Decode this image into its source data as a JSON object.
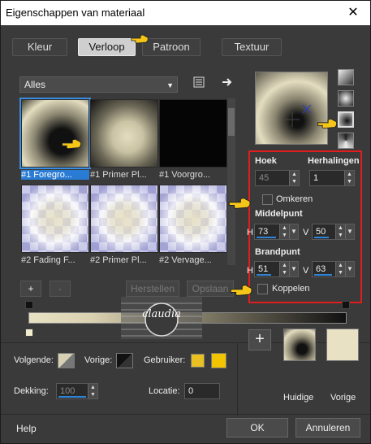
{
  "window": {
    "title": "Eigenschappen van materiaal",
    "close_glyph": "✕"
  },
  "tabs": [
    {
      "label": "Kleur",
      "active": false
    },
    {
      "label": "Verloop",
      "active": true
    },
    {
      "label": "Patroon",
      "active": false
    },
    {
      "label": "Textuur",
      "active": false
    }
  ],
  "category": {
    "value": "Alles",
    "options_icon": "list-icon",
    "next_icon": "arrow-right-icon"
  },
  "gradients": [
    {
      "label": "#1 Foregro...",
      "selected": true
    },
    {
      "label": "#1 Primer Pl...",
      "selected": false
    },
    {
      "label": "#1 Voorgro...",
      "selected": false
    },
    {
      "label": "#2 Fading F...",
      "selected": false
    },
    {
      "label": "#2 Primer Pl...",
      "selected": false
    },
    {
      "label": "#2 Vervage...",
      "selected": false
    }
  ],
  "library_buttons": {
    "add": "+",
    "remove": "-",
    "restore": "Herstellen",
    "save": "Opslaan"
  },
  "properties": {
    "angle": {
      "label": "Hoek",
      "value": "45"
    },
    "repeats": {
      "label": "Herhalingen",
      "value": "1"
    },
    "invert": {
      "label": "Omkeren",
      "checked": false
    },
    "center": {
      "label": "Middelpunt",
      "h_prefix": "H",
      "v_prefix": "V",
      "h": "73",
      "v": "50"
    },
    "focal": {
      "label": "Brandpunt",
      "h_prefix": "H",
      "v_prefix": "V",
      "h": "51",
      "v": "63"
    },
    "link": {
      "label": "Koppelen",
      "checked": false
    }
  },
  "bottom": {
    "next_label": "Volgende:",
    "prev_label": "Vorige:",
    "user_label": "Gebruiker:",
    "opacity_label": "Dekking:",
    "opacity_value": "100",
    "location_label": "Locatie:",
    "location_value": "0",
    "add_glyph": "+",
    "current_label": "Huidige",
    "previous_label": "Vorige",
    "user_colors": [
      "#e8c021",
      "#f2c300"
    ]
  },
  "footer": {
    "help": "Help",
    "ok": "OK",
    "cancel": "Annuleren"
  },
  "watermark": {
    "text": "claudia"
  },
  "colors": {
    "accent": "#2f86d8",
    "highlight": "#e11d1d",
    "gradient_light": "#e8e1c3",
    "gradient_dark": "#111111"
  }
}
